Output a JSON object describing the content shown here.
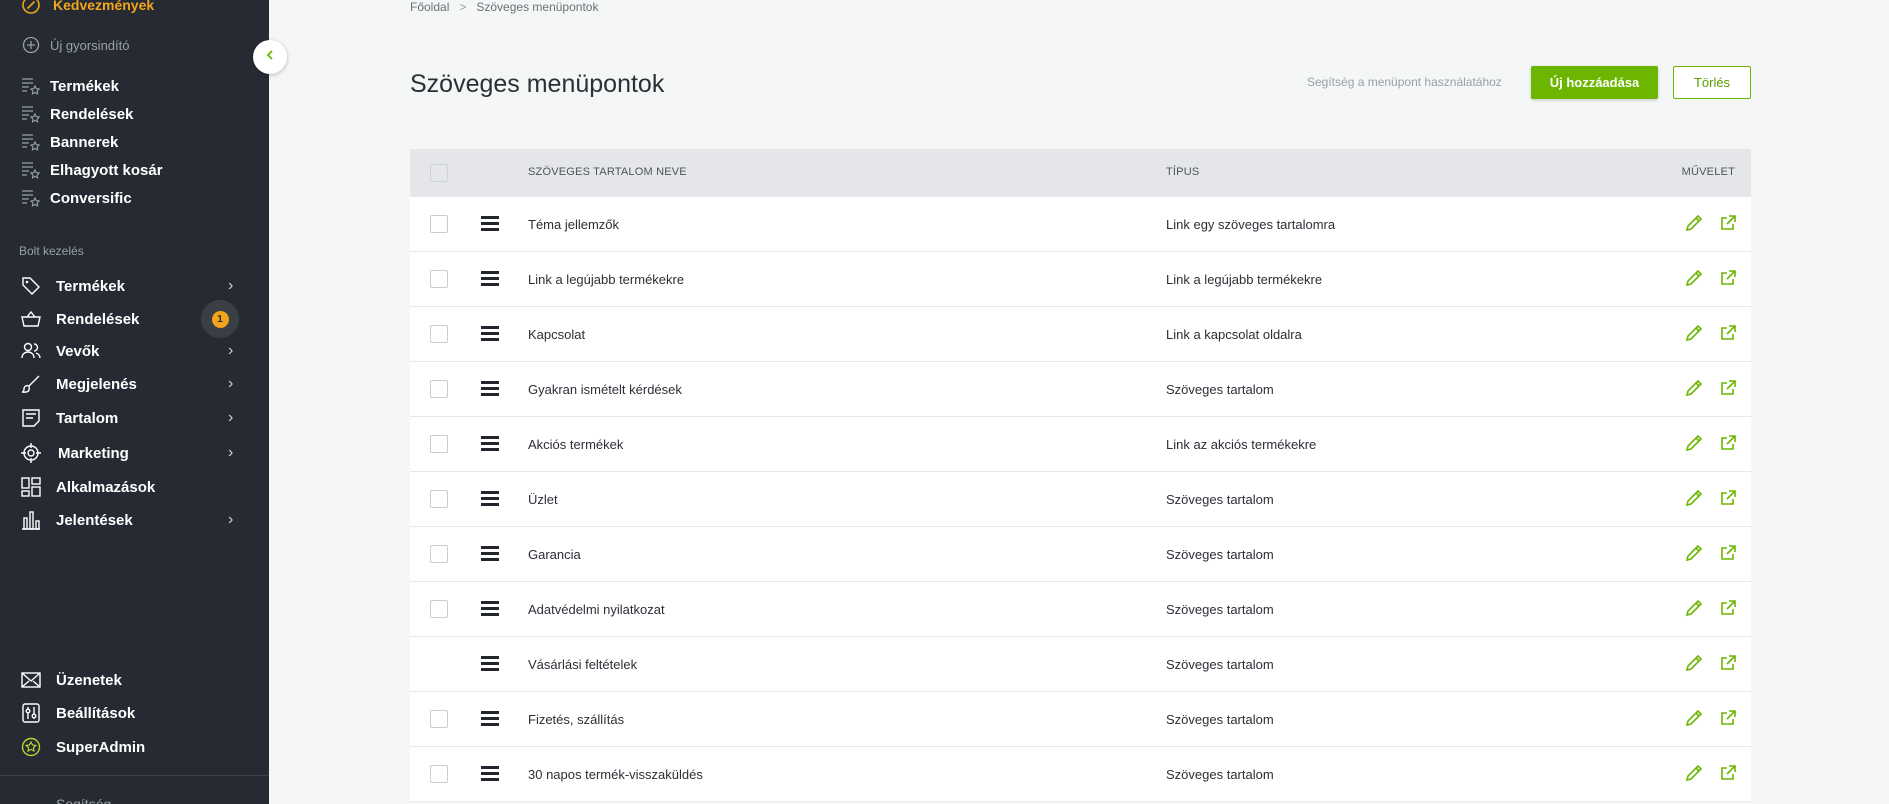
{
  "sidebar": {
    "favorites_label": "Kedvezmények",
    "new_shortcut_label": "Új gyorsindító",
    "favorites": [
      "Termékek",
      "Rendelések",
      "Bannerek",
      "Elhagyott kosár",
      "Conversific"
    ],
    "section_label": "Bolt kezelés",
    "shop": [
      {
        "label": "Termékek",
        "icon": "tag-icon"
      },
      {
        "label": "Rendelések",
        "icon": "basket-icon",
        "badge": "1"
      },
      {
        "label": "Vevők",
        "icon": "users-icon"
      },
      {
        "label": "Megjelenés",
        "icon": "brush-icon"
      },
      {
        "label": "Tartalom",
        "icon": "content-icon"
      },
      {
        "label": "Marketing",
        "icon": "target-icon"
      },
      {
        "label": "Alkalmazások",
        "icon": "apps-icon"
      },
      {
        "label": "Jelentések",
        "icon": "chart-icon"
      }
    ],
    "bottom": [
      {
        "label": "Üzenetek",
        "icon": "envelope-icon"
      },
      {
        "label": "Beállítások",
        "icon": "sliders-icon"
      },
      {
        "label": "SuperAdmin",
        "icon": "superadmin-icon"
      }
    ],
    "help_partial": "Segítség"
  },
  "breadcrumb": {
    "home": "Főoldal",
    "sep": ">",
    "current": "Szöveges menüpontok"
  },
  "page": {
    "title": "Szöveges menüpontok",
    "help_link": "Segítség a menüpont használatához",
    "add_button": "Új hozzáadása",
    "delete_button": "Törlés"
  },
  "table": {
    "headers": {
      "name": "SZÖVEGES TARTALOM NEVE",
      "type": "TÍPUS",
      "action": "MŰVELET"
    },
    "rows": [
      {
        "name": "Téma jellemzők",
        "type": "Link egy szöveges tartalomra",
        "checkbox": true
      },
      {
        "name": "Link a legújabb termékekre",
        "type": "Link a legújabb termékekre",
        "checkbox": true
      },
      {
        "name": "Kapcsolat",
        "type": "Link a kapcsolat oldalra",
        "checkbox": true
      },
      {
        "name": "Gyakran ismételt kérdések",
        "type": "Szöveges tartalom",
        "checkbox": true
      },
      {
        "name": "Akciós termékek",
        "type": "Link az akciós termékekre",
        "checkbox": true
      },
      {
        "name": "Üzlet",
        "type": "Szöveges tartalom",
        "checkbox": true
      },
      {
        "name": "Garancia",
        "type": "Szöveges tartalom",
        "checkbox": true
      },
      {
        "name": "Adatvédelmi nyilatkozat",
        "type": "Szöveges tartalom",
        "checkbox": true
      },
      {
        "name": "Vásárlási feltételek",
        "type": "Szöveges tartalom",
        "checkbox": false
      },
      {
        "name": "Fizetés, szállítás",
        "type": "Szöveges tartalom",
        "checkbox": true
      },
      {
        "name": "30 napos termék-visszaküldés",
        "type": "Szöveges tartalom",
        "checkbox": true
      }
    ]
  },
  "colors": {
    "sidebar_bg": "#262b33",
    "accent_green": "#6cb500",
    "accent_orange": "#f2a51a"
  }
}
